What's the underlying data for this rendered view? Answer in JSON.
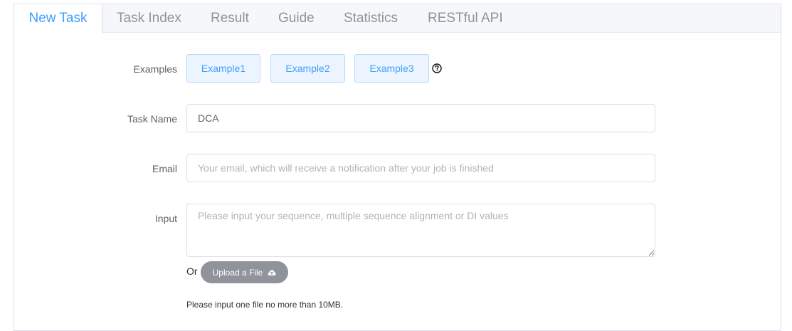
{
  "tabs": [
    {
      "label": "New Task",
      "active": true
    },
    {
      "label": "Task Index"
    },
    {
      "label": "Result"
    },
    {
      "label": "Guide"
    },
    {
      "label": "Statistics"
    },
    {
      "label": "RESTful API"
    }
  ],
  "form": {
    "examples_label": "Examples",
    "examples": [
      "Example1",
      "Example2",
      "Example3"
    ],
    "help_icon": "question-circle-icon",
    "task_name_label": "Task Name",
    "task_name_value": "DCA",
    "email_label": "Email",
    "email_placeholder": "Your email, which will receive a notification after your job is finished",
    "input_label": "Input",
    "input_placeholder": "Please input your sequence, multiple sequence alignment or DI values",
    "or_text": "Or",
    "upload_label": "Upload a File",
    "upload_icon": "cloud-upload-icon",
    "hint": "Please input one file no more than 10MB."
  },
  "colors": {
    "accent": "#409eff",
    "tab_bar_bg": "#f5f7fa",
    "example_bg": "#ecf5ff",
    "example_border": "#b3d8ff",
    "upload_bg": "#8f939a"
  }
}
